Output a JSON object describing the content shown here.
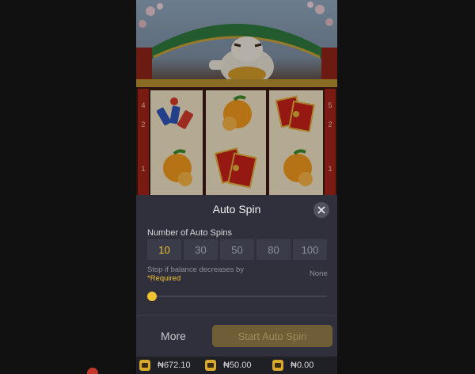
{
  "panel": {
    "title": "Auto Spin",
    "count_label": "Number of Auto Spins",
    "spin_options": [
      "10",
      "30",
      "50",
      "80",
      "100"
    ],
    "selected_option": "10",
    "stop_label": "Stop if balance decreases by",
    "required_label": "*Required",
    "stop_value": "None",
    "slider_level": 0,
    "more_label": "More",
    "start_label": "Start Auto Spin"
  },
  "footer": {
    "balance": "₦672.10",
    "bet": "₦50.00",
    "win": "₦0.00"
  },
  "reels": {
    "side_numbers_left": [
      "4",
      "2",
      "1"
    ],
    "side_numbers_right": [
      "5",
      "2",
      "1"
    ],
    "symbols": [
      [
        "firecrackers-icon",
        "orange-icon",
        "red-envelope-icon"
      ],
      [
        "orange-icon",
        "red-envelope-icon",
        "orange-icon"
      ]
    ]
  },
  "colors": {
    "accent": "#f1c232",
    "panel_bg": "#2f303c",
    "start_button": "#6e5d35"
  }
}
